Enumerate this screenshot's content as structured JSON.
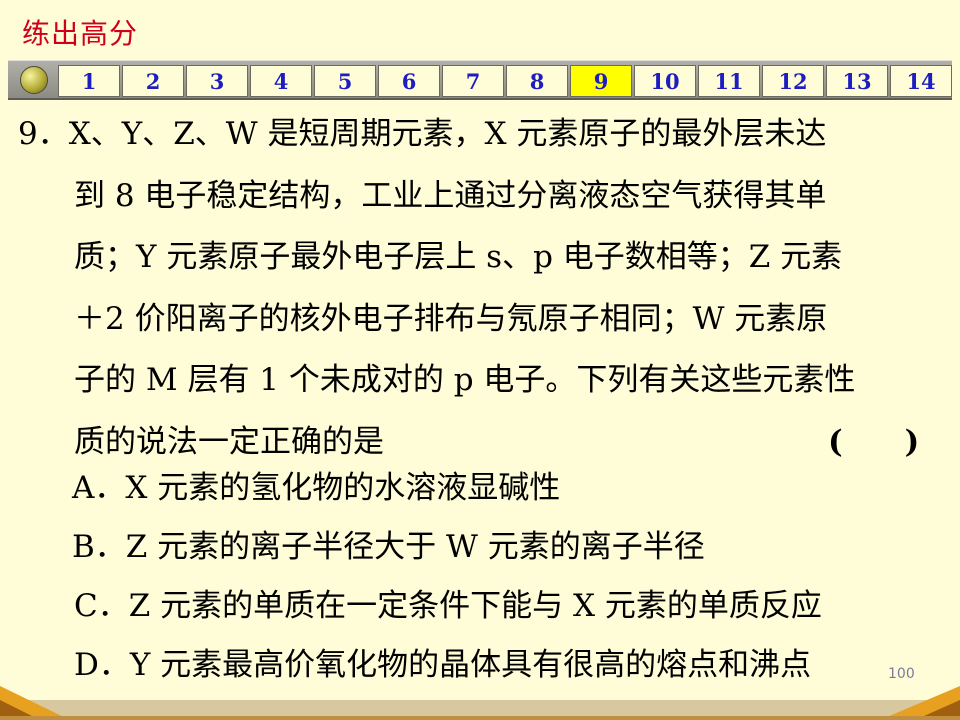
{
  "header": {
    "title": "练出高分"
  },
  "nav": {
    "tabs": [
      "1",
      "2",
      "3",
      "4",
      "5",
      "6",
      "7",
      "8",
      "9",
      "10",
      "11",
      "12",
      "13",
      "14"
    ],
    "active": "9"
  },
  "question": {
    "lines": [
      "9．X、Y、Z、W 是短周期元素，X 元素原子的最外层未达",
      "到 8 电子稳定结构，工业上通过分离液态空气获得其单",
      "质；Y 元素原子最外电子层上 s、p 电子数相等；Z 元素",
      "＋2 价阳离子的核外电子排布与氖原子相同；W 元素原",
      "子的 M 层有 1 个未成对的 p 电子。下列有关这些元素性",
      "质的说法一定正确的是"
    ],
    "answer_blank": "(　　)"
  },
  "options": [
    "A．X 元素的氢化物的水溶液显碱性",
    "B．Z 元素的离子半径大于 W 元素的离子半径",
    "C．Z 元素的单质在一定条件下能与 X 元素的单质反应",
    "D．Y 元素最高价氧化物的晶体具有很高的熔点和沸点"
  ],
  "footer": {
    "page_number": "100"
  },
  "colors": {
    "background": "#fefdd8",
    "title": "#d0001a",
    "tab_text": "#1d1dc0",
    "tab_active": "#ffff00",
    "floor_accent": "#e8a020"
  }
}
